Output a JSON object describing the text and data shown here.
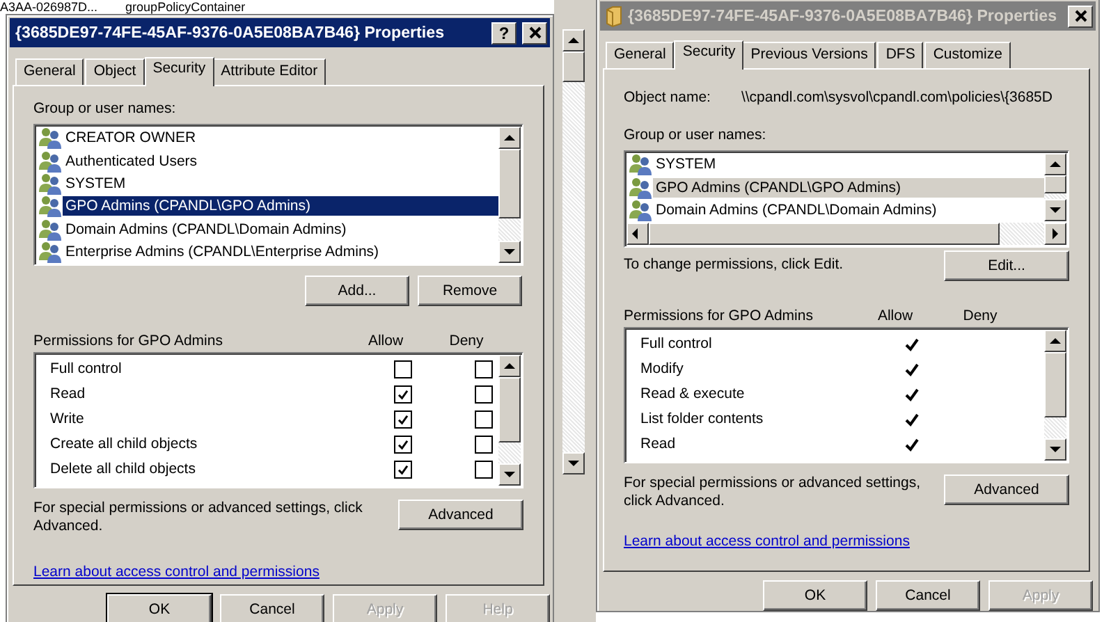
{
  "background": {
    "name_text": "A3AA-026987D...",
    "class_text": "groupPolicyContainer"
  },
  "dialogs": [
    {
      "title": "{3685DE97-74FE-45AF-9376-0A5E08BA7B46} Properties",
      "active": true,
      "title_icon": false,
      "help_label": "?",
      "tabs": [
        {
          "label": "General",
          "selected": false
        },
        {
          "label": "Object",
          "selected": false
        },
        {
          "label": "Security",
          "selected": true
        },
        {
          "label": "Attribute Editor",
          "selected": false
        }
      ],
      "groups_label": "Group or user names:",
      "groups": [
        {
          "name": "CREATOR OWNER",
          "selected": false
        },
        {
          "name": "Authenticated Users",
          "selected": false
        },
        {
          "name": "SYSTEM",
          "selected": false
        },
        {
          "name": "GPO Admins (CPANDL\\GPO Admins)",
          "selected": true
        },
        {
          "name": "Domain Admins (CPANDL\\Domain Admins)",
          "selected": false
        },
        {
          "name": "Enterprise Admins (CPANDL\\Enterprise Admins)",
          "selected": false
        }
      ],
      "group_buttons": [
        "Add...",
        "Remove"
      ],
      "permissions_label": "Permissions for GPO Admins",
      "allow_label": "Allow",
      "deny_label": "Deny",
      "permissions": [
        {
          "kind": "checkbox",
          "name": "Full control",
          "allow": false,
          "deny": false
        },
        {
          "kind": "checkbox",
          "name": "Read",
          "allow": true,
          "deny": false
        },
        {
          "kind": "checkbox",
          "name": "Write",
          "allow": true,
          "deny": false
        },
        {
          "kind": "checkbox",
          "name": "Create all child objects",
          "allow": true,
          "deny": false
        },
        {
          "kind": "checkbox",
          "name": "Delete all child objects",
          "allow": true,
          "deny": false
        }
      ],
      "advanced_text": "For special permissions or advanced settings, click Advanced.",
      "advanced_button": "Advanced",
      "link": "Learn about access control and permissions",
      "buttons": [
        {
          "label": "OK",
          "default": true,
          "disabled": false
        },
        {
          "label": "Cancel",
          "default": false,
          "disabled": false
        },
        {
          "label": "Apply",
          "default": false,
          "disabled": true
        },
        {
          "label": "Help",
          "default": false,
          "disabled": true
        }
      ]
    },
    {
      "title": "{3685DE97-74FE-45AF-9376-0A5E08BA7B46} Properties",
      "active": false,
      "title_icon": true,
      "tabs": [
        {
          "label": "General",
          "selected": false
        },
        {
          "label": "Security",
          "selected": true
        },
        {
          "label": "Previous Versions",
          "selected": false
        },
        {
          "label": "DFS",
          "selected": false
        },
        {
          "label": "Customize",
          "selected": false
        }
      ],
      "object_name_label": "Object name:",
      "object_name": "\\\\cpandl.com\\sysvol\\cpandl.com\\policies\\{3685D",
      "groups_label": "Group or user names:",
      "groups": [
        {
          "name": "SYSTEM",
          "selected": false
        },
        {
          "name": "GPO Admins (CPANDL\\GPO Admins)",
          "selected": true
        },
        {
          "name": "Domain Admins (CPANDL\\Domain Admins)",
          "selected": false
        }
      ],
      "horizontal_scrollbar": true,
      "edit_text": "To change permissions, click Edit.",
      "edit_button": "Edit...",
      "permissions_label": "Permissions for GPO Admins",
      "allow_label": "Allow",
      "deny_label": "Deny",
      "permissions": [
        {
          "kind": "checkmark",
          "name": "Full control",
          "allow": true,
          "deny": false
        },
        {
          "kind": "checkmark",
          "name": "Modify",
          "allow": true,
          "deny": false
        },
        {
          "kind": "checkmark",
          "name": "Read & execute",
          "allow": true,
          "deny": false
        },
        {
          "kind": "checkmark",
          "name": "List folder contents",
          "allow": true,
          "deny": false
        },
        {
          "kind": "checkmark",
          "name": "Read",
          "allow": true,
          "deny": false
        }
      ],
      "advanced_text": "For special permissions or advanced settings, click Advanced.",
      "advanced_button": "Advanced",
      "link": "Learn about access control and permissions",
      "buttons": [
        {
          "label": "OK",
          "default": false,
          "disabled": false
        },
        {
          "label": "Cancel",
          "default": false,
          "disabled": false
        },
        {
          "label": "Apply",
          "default": false,
          "disabled": true
        }
      ]
    }
  ]
}
